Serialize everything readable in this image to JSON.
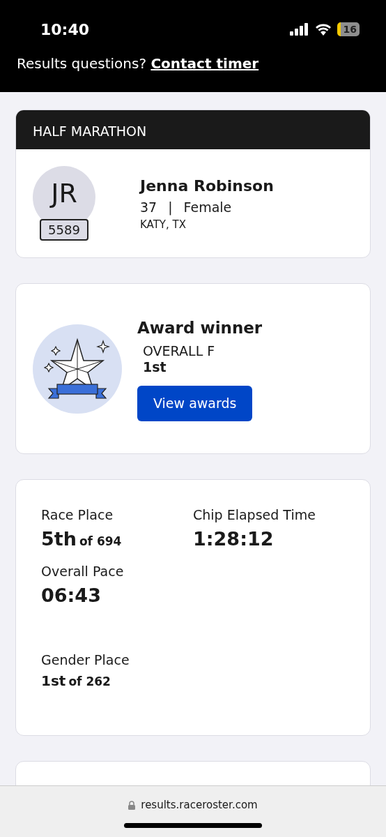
{
  "status_bar": {
    "time": "10:40",
    "battery": "16"
  },
  "header": {
    "question": "Results questions?",
    "link": "Contact timer"
  },
  "race": {
    "title": "HALF MARATHON",
    "initials": "JR",
    "bib": "5589",
    "name": "Jenna Robinson",
    "age": "37",
    "separator": "|",
    "gender": "Female",
    "location": "KATY, TX"
  },
  "award": {
    "title": "Award winner",
    "category": "OVERALL F",
    "place": "1st",
    "button": "View awards"
  },
  "stats": [
    {
      "label": "Race Place",
      "value": "5th",
      "suffix": "of 694",
      "kind": "headline"
    },
    {
      "label": "Chip Elapsed Time",
      "value": "1:28:12",
      "kind": "headline"
    },
    {
      "label": "Overall Pace",
      "value": "06:43",
      "kind": "headline"
    },
    {
      "label": "Gender Place",
      "value": "1st",
      "suffix": "of 262",
      "kind": "compact"
    }
  ],
  "browser": {
    "url": "results.raceroster.com"
  }
}
